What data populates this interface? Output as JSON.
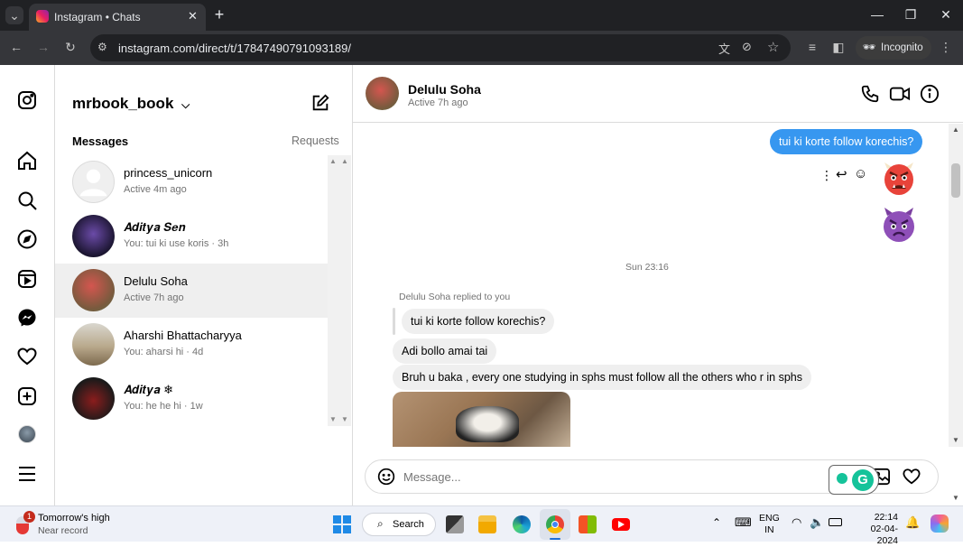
{
  "browser": {
    "tab_title": "Instagram • Chats",
    "url": "instagram.com/direct/t/17847490791093189/",
    "incognito_label": "Incognito"
  },
  "inbox": {
    "username": "mrbook_book",
    "messages_label": "Messages",
    "requests_label": "Requests",
    "conversations": [
      {
        "name": "princess_unicorn",
        "sub": "Active 4m ago"
      },
      {
        "name": "𝑨𝒅𝒊𝒕𝒚𝒂 𝑺𝒆𝒏",
        "sub": "You: tui ki use koris · 3h"
      },
      {
        "name": "Delulu Soha",
        "sub": "Active 7h ago"
      },
      {
        "name": "Aharshi Bhattacharyya",
        "sub": "You: aharsi hi · 4d"
      },
      {
        "name": "𝑨𝒅𝒊𝒕𝒚𝒂 ❄",
        "sub": "You: he he hi · 1w"
      }
    ]
  },
  "chat": {
    "name": "Delulu Soha",
    "status": "Active 7h ago",
    "timestamp": "Sun 23:16",
    "replied_note": "Delulu Soha replied to you",
    "messages": {
      "sent_1": "tui ki korte follow korechis?",
      "quoted": "tui ki korte follow korechis?",
      "recv_1": "Adi bollo amai tai",
      "recv_2": "Bruh u baka , every one studying in sphs must follow all the others who r in sphs"
    },
    "composer_placeholder": "Message..."
  },
  "taskbar": {
    "weather_title": "Tomorrow's high",
    "weather_sub": "Near record",
    "weather_badge": "1",
    "search_label": "Search",
    "lang_1": "ENG",
    "lang_2": "IN",
    "time": "22:14",
    "date": "02-04-2024"
  },
  "colors": {
    "accent_blue": "#3797f0",
    "browser_dark": "#202124",
    "taskbar_bg": "#eef1f8"
  }
}
